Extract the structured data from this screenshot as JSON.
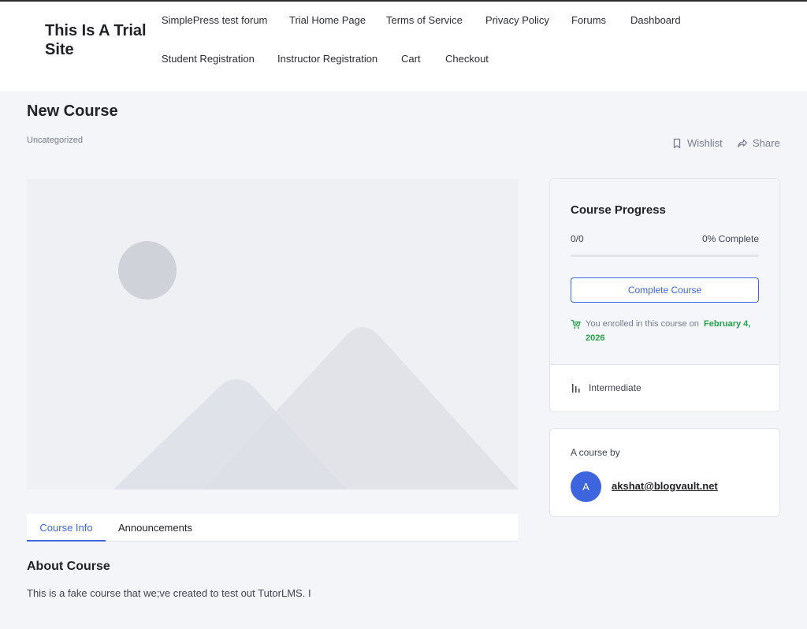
{
  "site": {
    "title": "This Is A Trial Site"
  },
  "nav": {
    "items": [
      "SimplePress test forum",
      "Trial Home Page",
      "Terms of Service",
      "Privacy Policy",
      "Forums",
      "Dashboard",
      "Student Registration",
      "Instructor Registration",
      "Cart",
      "Checkout"
    ]
  },
  "course": {
    "title": "New Course",
    "category": "Uncategorized",
    "wishlist_label": "Wishlist",
    "share_label": "Share",
    "thumbnail_icon": "image-placeholder-icon"
  },
  "tabs": {
    "items": [
      "Course Info",
      "Announcements"
    ],
    "active": "Course Info"
  },
  "about": {
    "title": "About Course",
    "text": "This is a fake course that we;ve created to test out TutorLMS. I"
  },
  "progress": {
    "title": "Course Progress",
    "count": "0/0",
    "percent_label": "0% Complete",
    "percent_value": 0,
    "complete_button": "Complete Course",
    "enrolled_text": "You enrolled in this course on",
    "enrolled_date": "February 4, 2026",
    "level": "Intermediate"
  },
  "author": {
    "label": "A course by",
    "avatar_initial": "A",
    "name": "akshat@blogvault.net"
  },
  "colors": {
    "accent": "#3e64de",
    "success": "#24a148",
    "muted": "#757c8e",
    "page_bg": "#f4f5f8"
  }
}
